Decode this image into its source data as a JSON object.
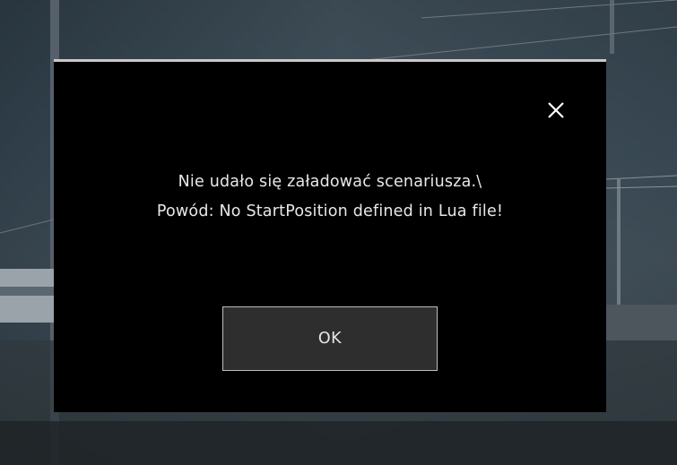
{
  "dialog": {
    "message_line_1": "Nie udało się załadować scenariusza.\\",
    "message_line_2": "Powód: No StartPosition defined in Lua file!",
    "ok_label": "OK",
    "close_icon": "close-icon"
  },
  "colors": {
    "dialog_background": "#000000",
    "button_background": "#2e2e2e",
    "text": "#e8e8e8"
  }
}
